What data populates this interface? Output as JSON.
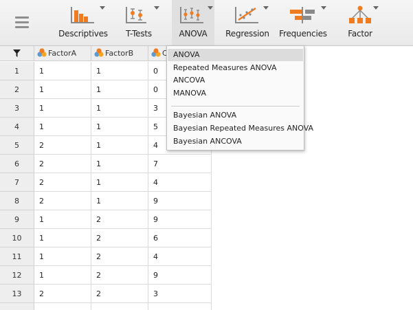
{
  "toolbar": {
    "buttons": [
      {
        "id": "descriptives",
        "label": "Descriptives",
        "icon": "bar-chart-icon"
      },
      {
        "id": "ttests",
        "label": "T-Tests",
        "icon": "t-test-icon"
      },
      {
        "id": "anova",
        "label": "ANOVA",
        "icon": "anova-icon"
      },
      {
        "id": "regression",
        "label": "Regression",
        "icon": "regression-icon"
      },
      {
        "id": "frequencies",
        "label": "Frequencies",
        "icon": "frequencies-icon"
      },
      {
        "id": "factor",
        "label": "Factor",
        "icon": "factor-icon"
      }
    ],
    "active": "anova"
  },
  "grid": {
    "columns": [
      {
        "name": "FactorA",
        "type": "nominal"
      },
      {
        "name": "FactorB",
        "type": "nominal"
      },
      {
        "name": "C",
        "type": "nominal"
      }
    ],
    "rows": [
      {
        "n": "1",
        "values": [
          "1",
          "1",
          "0"
        ]
      },
      {
        "n": "2",
        "values": [
          "1",
          "1",
          "0"
        ]
      },
      {
        "n": "3",
        "values": [
          "1",
          "1",
          "3"
        ]
      },
      {
        "n": "4",
        "values": [
          "1",
          "1",
          "5"
        ]
      },
      {
        "n": "5",
        "values": [
          "2",
          "1",
          "4"
        ]
      },
      {
        "n": "6",
        "values": [
          "2",
          "1",
          "7"
        ]
      },
      {
        "n": "7",
        "values": [
          "2",
          "1",
          "4"
        ]
      },
      {
        "n": "8",
        "values": [
          "2",
          "1",
          "9"
        ]
      },
      {
        "n": "9",
        "values": [
          "1",
          "2",
          "9"
        ]
      },
      {
        "n": "10",
        "values": [
          "1",
          "2",
          "6"
        ]
      },
      {
        "n": "11",
        "values": [
          "1",
          "2",
          "4"
        ]
      },
      {
        "n": "12",
        "values": [
          "1",
          "2",
          "9"
        ]
      },
      {
        "n": "13",
        "values": [
          "2",
          "2",
          "3"
        ]
      }
    ]
  },
  "anova_menu": {
    "items": [
      {
        "label": "ANOVA",
        "selected": true
      },
      {
        "label": "Repeated Measures ANOVA",
        "selected": false
      },
      {
        "label": "ANCOVA",
        "selected": false
      },
      {
        "label": "MANOVA",
        "selected": false
      },
      {
        "label": "Bayesian ANOVA",
        "selected": false
      },
      {
        "label": "Bayesian Repeated Measures ANOVA",
        "selected": false
      },
      {
        "label": "Bayesian ANCOVA",
        "selected": false
      }
    ]
  },
  "colors": {
    "icon_orange": "#f07c21",
    "icon_gray": "#8a8a8a",
    "nominal_orange": "#f5a623",
    "nominal_blue": "#5b9bd5",
    "menu_highlight": "#dcdcdc"
  }
}
